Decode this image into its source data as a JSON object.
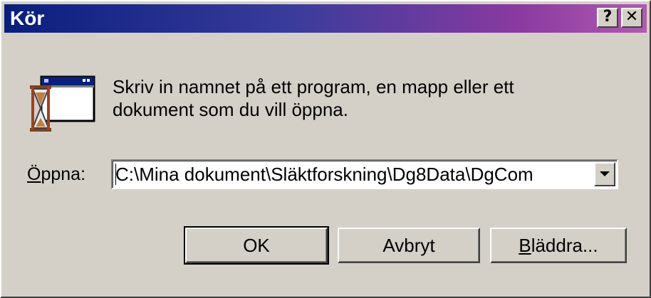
{
  "window": {
    "title": "Kör",
    "help_label": "?",
    "close_label": "✕"
  },
  "prompt": {
    "line1": "Skriv in namnet på ett program, en mapp eller ett",
    "line2": "dokument som du vill öppna."
  },
  "open_field": {
    "label_first": "Ö",
    "label_rest": "ppna:",
    "value": "C:\\Mina dokument\\Släktforskning\\Dg8Data\\DgCom"
  },
  "buttons": {
    "ok_label": "OK",
    "cancel_label": "Avbryt",
    "browse_first": "B",
    "browse_rest": "läddra..."
  },
  "icons": {
    "run_icon": "run-program-icon",
    "dropdown": "chevron-down-icon"
  },
  "colors": {
    "title_gradient_start": "#0a1e7c",
    "title_gradient_end": "#b05ab0",
    "face": "#d4d0c8"
  }
}
